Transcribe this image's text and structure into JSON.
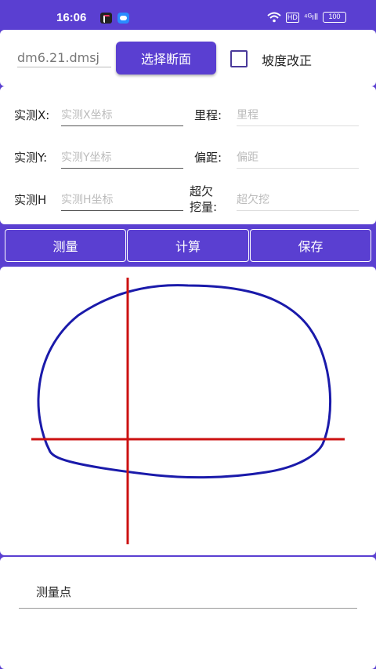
{
  "status_bar": {
    "time": "16:06",
    "hd_label": "HD",
    "signal_label": "⁴ᴳıll",
    "battery": "100"
  },
  "top": {
    "file_name": "dm6.21.dmsj",
    "select_button": "选择断面",
    "slope_checkbox_label": "坡度改正",
    "slope_checked": false
  },
  "form": {
    "x_label": "实测X:",
    "x_placeholder": "实测X坐标",
    "mileage_label": "里程:",
    "mileage_placeholder": "里程",
    "y_label": "实测Y:",
    "y_placeholder": "实测Y坐标",
    "offset_label": "偏距:",
    "offset_placeholder": "偏距",
    "h_label": "实测H",
    "h_placeholder": "实测H坐标",
    "overbreak_label_1": "超欠",
    "overbreak_label_2": "挖量:",
    "overbreak_placeholder": "超欠挖"
  },
  "actions": {
    "measure": "测量",
    "calculate": "计算",
    "save": "保存"
  },
  "canvas": {
    "profile_color": "#1a1aaa",
    "crosshair_color": "#cc1111"
  },
  "list": {
    "header": "测量点"
  }
}
